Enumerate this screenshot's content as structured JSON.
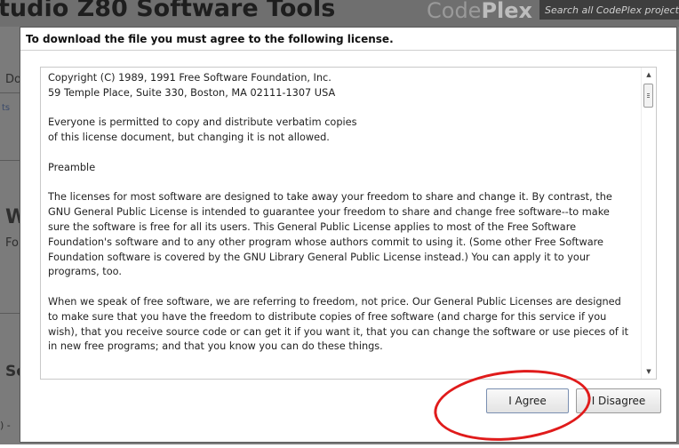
{
  "background": {
    "project_title": "tudio Z80 Software Tools",
    "logo_light": "Code",
    "logo_bold": "Plex",
    "search_placeholder": "Search all CodePlex projects",
    "fragments": {
      "d": "Do",
      "ts": "ts",
      "w": "W",
      "f": "Fo",
      "s": "So",
      "dash": ") -"
    }
  },
  "dialog": {
    "title": "To download the file you must agree to the following license.",
    "license": {
      "p1_l1": "Copyright (C) 1989, 1991 Free Software Foundation, Inc.",
      "p1_l2": "59 Temple Place, Suite 330, Boston, MA 02111-1307 USA",
      "p2_l1": "Everyone is permitted to copy and distribute verbatim copies",
      "p2_l2": "of this license document, but changing it is not allowed.",
      "p3": "Preamble",
      "p4": "The licenses for most software are designed to take away your freedom to share and change it. By contrast, the GNU General Public License is intended to guarantee your freedom to share and change free software--to make sure the software is free for all its users. This General Public License applies to most of the Free Software Foundation's software and to any other program whose authors commit to using it. (Some other Free Software Foundation software is covered by the GNU Library General Public License instead.) You can apply it to your programs, too.",
      "p5": "When we speak of free software, we are referring to freedom, not price. Our General Public Licenses are designed to make sure that you have the freedom to distribute copies of free software (and charge for this service if you wish), that you receive source code or can get it if you want it, that you can change the software or use pieces of it in new free programs; and that you know you can do these things."
    },
    "scrollbar": {
      "up_glyph": "▲",
      "down_glyph": "▼",
      "position": 0.0
    },
    "buttons": {
      "agree": "I Agree",
      "disagree": "I Disagree"
    }
  },
  "annotation": {
    "highlight_color": "#e01b1b"
  }
}
